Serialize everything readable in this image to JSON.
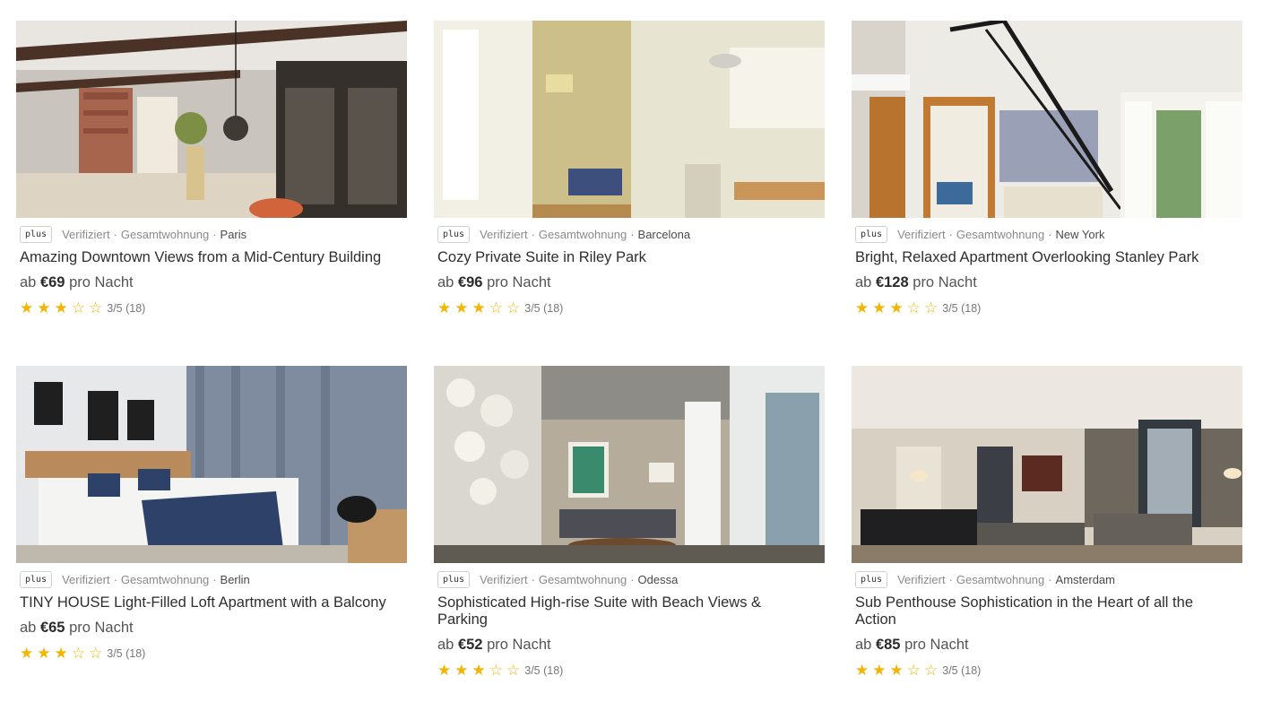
{
  "listings": [
    {
      "badge": "plus",
      "verified": "Verifiziert",
      "type": "Gesamtwohnung",
      "city": "Paris",
      "title": "Amazing Downtown Views from a Mid-Century Building",
      "price_prefix": "ab",
      "price": "€69",
      "price_suffix": "pro Nacht",
      "rating_value": 3,
      "rating_max": 5,
      "rating_text": "3/5 (18)",
      "photo_alt": "kitchen with brick oven and dark cabinet"
    },
    {
      "badge": "plus",
      "verified": "Verifiziert",
      "type": "Gesamtwohnung",
      "city": "Barcelona",
      "title": "Cozy Private Suite in Riley Park",
      "price_prefix": "ab",
      "price": "€96",
      "price_suffix": "pro Nacht",
      "rating_value": 3,
      "rating_max": 5,
      "rating_text": "3/5 (18)",
      "photo_alt": "bright apartment with kitchenette"
    },
    {
      "badge": "plus",
      "verified": "Verifiziert",
      "type": "Gesamtwohnung",
      "city": "New York",
      "title": "Bright, Relaxed Apartment Overlooking Stanley Park",
      "price_prefix": "ab",
      "price": "€128",
      "price_suffix": "pro Nacht",
      "rating_value": 3,
      "rating_max": 5,
      "rating_text": "3/5 (18)",
      "photo_alt": "loft with spiral staircase"
    },
    {
      "badge": "plus",
      "verified": "Verifiziert",
      "type": "Gesamtwohnung",
      "city": "Berlin",
      "title": "TINY HOUSE Light-Filled Loft Apartment with a Balcony",
      "price_prefix": "ab",
      "price": "€65",
      "price_suffix": "pro Nacht",
      "rating_value": 3,
      "rating_max": 5,
      "rating_text": "3/5 (18)",
      "photo_alt": "bedroom with grey curtains"
    },
    {
      "badge": "plus",
      "verified": "Verifiziert",
      "type": "Gesamtwohnung",
      "city": "Odessa",
      "title": "Sophisticated High-rise Suite with Beach Views & Parking",
      "price_prefix": "ab",
      "price": "€52",
      "price_suffix": "pro Nacht",
      "rating_value": 3,
      "rating_max": 5,
      "rating_text": "3/5 (18)",
      "photo_alt": "living room with shell chandelier"
    },
    {
      "badge": "plus",
      "verified": "Verifiziert",
      "type": "Gesamtwohnung",
      "city": "Amsterdam",
      "title": "Sub Penthouse Sophistication in the Heart of all the Action",
      "price_prefix": "ab",
      "price": "€85",
      "price_suffix": "pro Nacht",
      "rating_value": 3,
      "rating_max": 5,
      "rating_text": "3/5 (18)",
      "photo_alt": "open living and dining room"
    }
  ],
  "colors": {
    "star": "#f4b400",
    "text": "#2e2e2e",
    "muted": "#8a8a8a"
  },
  "icons": {
    "filled_star": "star-filled-icon",
    "empty_star": "star-empty-icon"
  }
}
